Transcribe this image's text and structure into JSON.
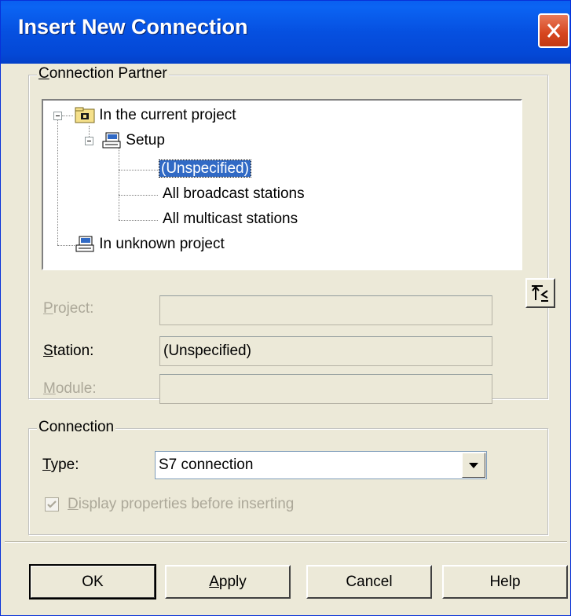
{
  "window": {
    "title": "Insert New Connection"
  },
  "partner_group": {
    "title_underlined": "C",
    "title_rest": "onnection Partner",
    "tree": {
      "current_project": "In the current project",
      "setup": "Setup",
      "unspecified": "(Unspecified)",
      "broadcast": "All broadcast stations",
      "multicast": "All multicast stations",
      "unknown_project": "In unknown project"
    },
    "project": {
      "label_u": "P",
      "label_rest": "roject:",
      "value": ""
    },
    "station": {
      "label_u": "S",
      "label_rest": "tation:",
      "value": "(Unspecified)"
    },
    "module": {
      "label_u": "M",
      "label_rest": "odule:",
      "value": ""
    }
  },
  "connection_group": {
    "title": "Connection",
    "type_label_u": "T",
    "type_label_rest": "ype:",
    "type_value": "S7 connection",
    "display_props_u": "D",
    "display_props_rest": "isplay properties before inserting",
    "display_props_checked": true
  },
  "buttons": {
    "ok": "OK",
    "apply_u": "A",
    "apply_rest": "pply",
    "cancel": "Cancel",
    "help": "Help"
  }
}
